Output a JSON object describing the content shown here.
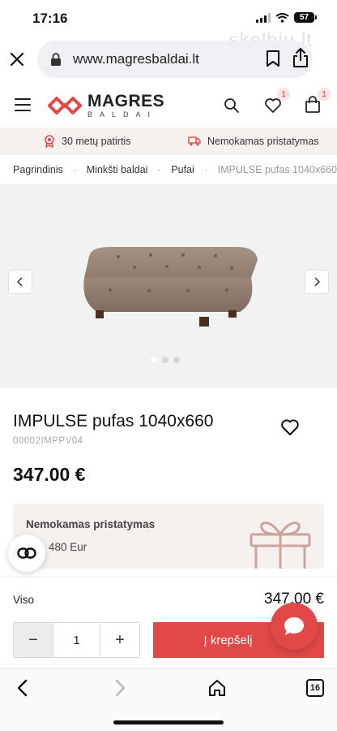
{
  "status": {
    "time": "17:16",
    "battery": "57"
  },
  "watermark": "skelbiu.lt",
  "browser": {
    "url": "www.magresbaldai.lt",
    "tabs_count": "16"
  },
  "header": {
    "logo_name": "MAGRES",
    "logo_sub": "BALDAI",
    "wishlist_count": "1",
    "cart_count": "1"
  },
  "usp": {
    "experience": "30 metų patirtis",
    "delivery": "Nemokamas pristatymas"
  },
  "breadcrumb": [
    "Pagrindinis",
    "Minkšti baldai",
    "Pufai",
    "IMPULSE pufas 1040x660"
  ],
  "product": {
    "title": "IMPULSE pufas 1040x660",
    "code": "00002IMPPV04",
    "price": "347.00 €"
  },
  "delivery_card": {
    "title": "Nemokamas pristatymas",
    "subtitle": "480 Eur"
  },
  "purchase": {
    "total_label": "Viso",
    "total_value": "347.00 €",
    "quantity": "1",
    "minus": "−",
    "plus": "+",
    "add_to_cart": "Į krepšelį"
  },
  "colors": {
    "accent": "#e24848",
    "panel": "#f6f1ef"
  }
}
